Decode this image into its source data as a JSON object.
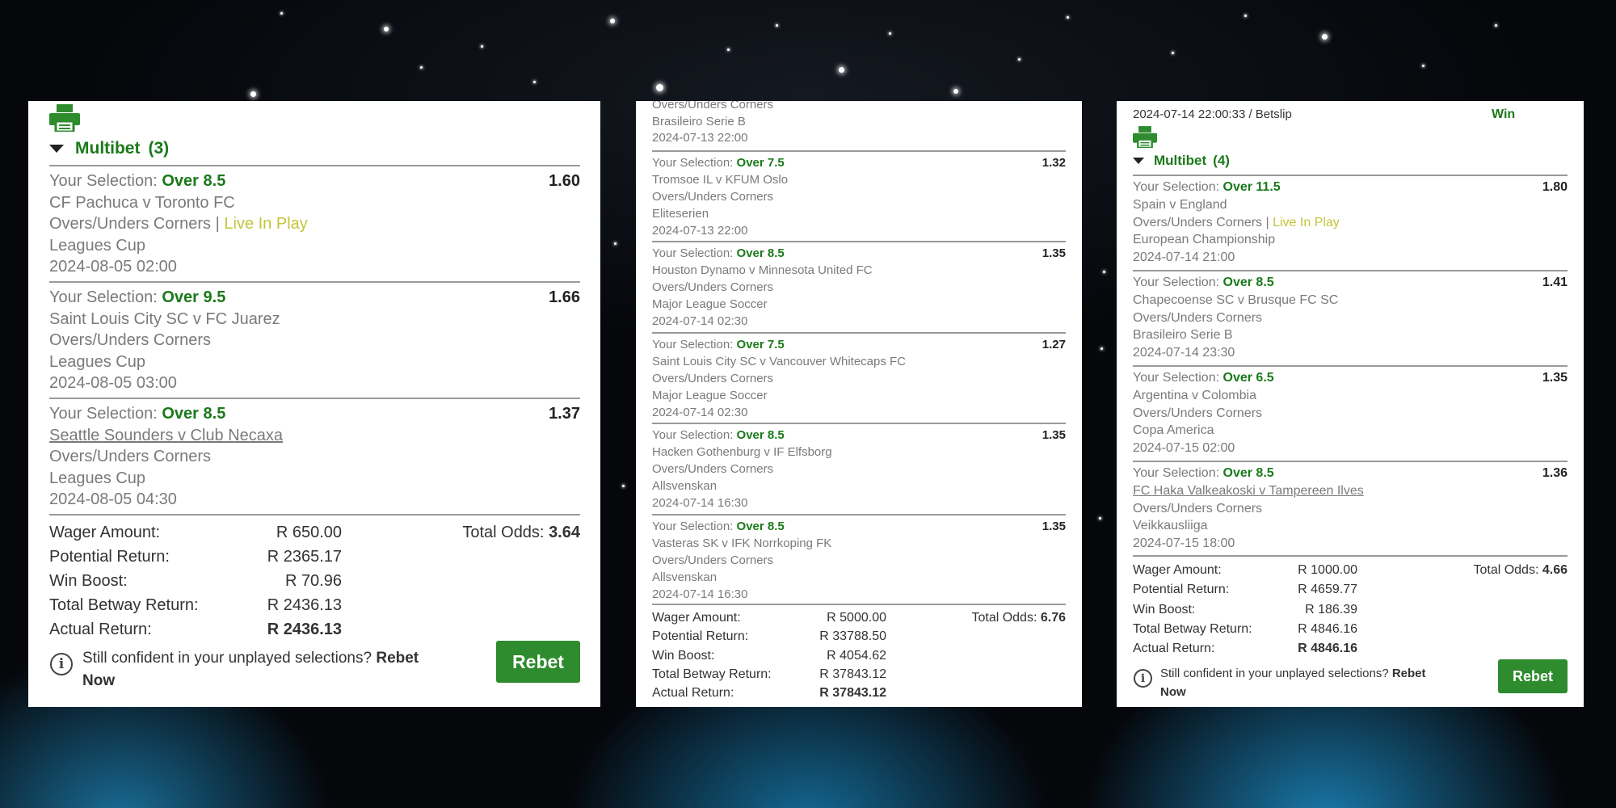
{
  "slip1": {
    "title": "Multibet",
    "count": "(3)",
    "legs": [
      {
        "sel_label": "Your Selection:",
        "selection": "Over 8.5",
        "odds": "1.60",
        "match": "CF Pachuca v Toronto FC",
        "market": "Overs/Unders Corners",
        "live": "Live In Play",
        "competition": "Leagues Cup",
        "date": "2024-08-05 02:00"
      },
      {
        "sel_label": "Your Selection:",
        "selection": "Over 9.5",
        "odds": "1.66",
        "match": "Saint Louis City SC v FC Juarez",
        "market": "Overs/Unders Corners",
        "live": "",
        "competition": "Leagues Cup",
        "date": "2024-08-05 03:00"
      },
      {
        "sel_label": "Your Selection:",
        "selection": "Over 8.5",
        "odds": "1.37",
        "match": "Seattle Sounders v Club Necaxa",
        "market": "Overs/Unders Corners",
        "live": "",
        "competition": "Leagues Cup",
        "date": "2024-08-05 04:30"
      }
    ],
    "summary": {
      "wager_label": "Wager Amount:",
      "wager": "R 650.00",
      "total_odds_label": "Total Odds:",
      "total_odds": "3.64",
      "potential_label": "Potential Return:",
      "potential": "R 2365.17",
      "boost_label": "Win Boost:",
      "boost": "R 70.96",
      "betway_label": "Total Betway Return:",
      "betway": "R 2436.13",
      "actual_label": "Actual Return:",
      "actual": "R 2436.13"
    },
    "confident_text": "Still confident in your unplayed selections?",
    "rebet_now": "Rebet Now",
    "rebet_button": "Rebet"
  },
  "slip2": {
    "top_market": "Overs/Unders Corners",
    "top_competition": "Brasileiro Serie B",
    "top_date": "2024-07-13 22:00",
    "legs": [
      {
        "sel_label": "Your Selection:",
        "selection": "Over 7.5",
        "odds": "1.32",
        "match": "Tromsoe IL v KFUM Oslo",
        "market": "Overs/Unders Corners",
        "competition": "Eliteserien",
        "date": "2024-07-13 22:00"
      },
      {
        "sel_label": "Your Selection:",
        "selection": "Over 8.5",
        "odds": "1.35",
        "match": "Houston Dynamo v Minnesota United FC",
        "market": "Overs/Unders Corners",
        "competition": "Major League Soccer",
        "date": "2024-07-14 02:30"
      },
      {
        "sel_label": "Your Selection:",
        "selection": "Over 7.5",
        "odds": "1.27",
        "match": "Saint Louis City SC v Vancouver Whitecaps FC",
        "market": "Overs/Unders Corners",
        "competition": "Major League Soccer",
        "date": "2024-07-14 02:30"
      },
      {
        "sel_label": "Your Selection:",
        "selection": "Over 8.5",
        "odds": "1.35",
        "match": "Hacken Gothenburg v IF Elfsborg",
        "market": "Overs/Unders Corners",
        "competition": "Allsvenskan",
        "date": "2024-07-14 16:30"
      },
      {
        "sel_label": "Your Selection:",
        "selection": "Over 8.5",
        "odds": "1.35",
        "match": "Vasteras SK v IFK Norrkoping FK",
        "market": "Overs/Unders Corners",
        "competition": "Allsvenskan",
        "date": "2024-07-14 16:30"
      }
    ],
    "summary": {
      "wager_label": "Wager Amount:",
      "wager": "R 5000.00",
      "total_odds_label": "Total Odds:",
      "total_odds": "6.76",
      "potential_label": "Potential Return:",
      "potential": "R 33788.50",
      "boost_label": "Win Boost:",
      "boost": "R 4054.62",
      "betway_label": "Total Betway Return:",
      "betway": "R 37843.12",
      "actual_label": "Actual Return:",
      "actual": "R 37843.12"
    }
  },
  "slip3": {
    "header_text": "2024-07-14 22:00:33 / Betslip",
    "status": "Win",
    "title": "Multibet",
    "count": "(4)",
    "legs": [
      {
        "sel_label": "Your Selection:",
        "selection": "Over 11.5",
        "odds": "1.80",
        "match": "Spain v England",
        "market": "Overs/Unders Corners",
        "live": "Live In Play",
        "competition": "European Championship",
        "date": "2024-07-14 21:00"
      },
      {
        "sel_label": "Your Selection:",
        "selection": "Over 8.5",
        "odds": "1.41",
        "match": "Chapecoense SC v Brusque FC SC",
        "market": "Overs/Unders Corners",
        "live": "",
        "competition": "Brasileiro Serie B",
        "date": "2024-07-14 23:30"
      },
      {
        "sel_label": "Your Selection:",
        "selection": "Over 6.5",
        "odds": "1.35",
        "match": "Argentina v Colombia",
        "market": "Overs/Unders Corners",
        "live": "",
        "competition": "Copa America",
        "date": "2024-07-15 02:00"
      },
      {
        "sel_label": "Your Selection:",
        "selection": "Over 8.5",
        "odds": "1.36",
        "match": "FC Haka Valkeakoski v Tampereen Ilves",
        "market": "Overs/Unders Corners",
        "live": "",
        "competition": "Veikkausliiga",
        "date": "2024-07-15 18:00"
      }
    ],
    "summary": {
      "wager_label": "Wager Amount:",
      "wager": "R 1000.00",
      "total_odds_label": "Total Odds:",
      "total_odds": "4.66",
      "potential_label": "Potential Return:",
      "potential": "R 4659.77",
      "boost_label": "Win Boost:",
      "boost": "R 186.39",
      "betway_label": "Total Betway Return:",
      "betway": "R 4846.16",
      "actual_label": "Actual Return:",
      "actual": "R 4846.16"
    },
    "confident_text": "Still confident in your unplayed selections?",
    "rebet_now": "Rebet Now",
    "rebet_button": "Rebet"
  },
  "colors": {
    "accent_green": "#1a7a1a",
    "live_yellow": "#c4c43a",
    "button_green": "#2e8b2e"
  }
}
